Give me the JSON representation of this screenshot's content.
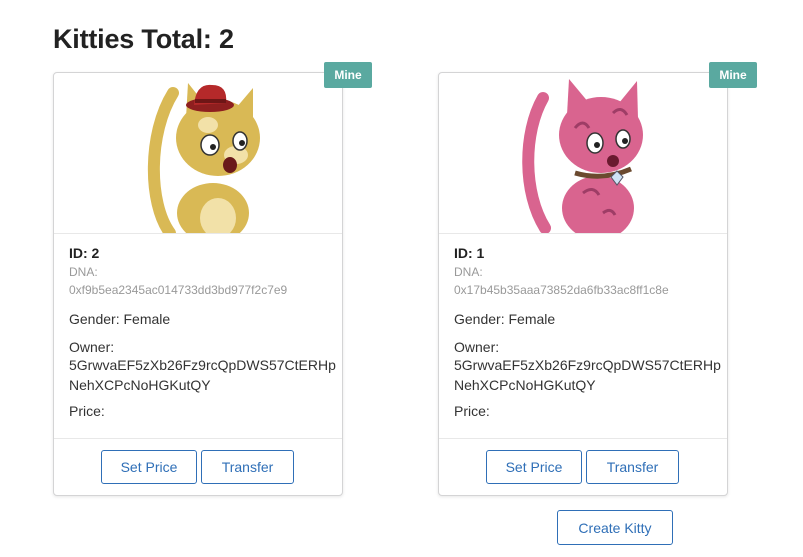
{
  "header": {
    "title": "Kitties Total: 2"
  },
  "kitties": [
    {
      "badge": "Mine",
      "id": "ID: 2",
      "dna_label": "DNA:",
      "dna": "0xf9b5ea2345ac014733dd3bd977f2c7e9",
      "gender": "Gender: Female",
      "owner_label": "Owner:",
      "owner": "5GrwvaEF5zXb26Fz9rcQpDWS57CtERHpNehXCPcNoHGKutQY",
      "price": "Price:",
      "set_price_label": "Set Price",
      "transfer_label": "Transfer",
      "image": "yellow-cat-with-red-hat",
      "body_color": "#d9b955",
      "accent_color": "#b5292a"
    },
    {
      "badge": "Mine",
      "id": "ID: 1",
      "dna_label": "DNA:",
      "dna": "0x17b45b35aaa73852da6fb33ac8ff1c8e",
      "gender": "Gender: Female",
      "owner_label": "Owner:",
      "owner": "5GrwvaEF5zXb26Fz9rcQpDWS57CtERHpNehXCPcNoHGKutQY",
      "price": "Price:",
      "set_price_label": "Set Price",
      "transfer_label": "Transfer",
      "image": "pink-cat-with-collar",
      "body_color": "#d9648f",
      "accent_color": "#9e3d66"
    }
  ],
  "actions": {
    "create_label": "Create Kitty"
  },
  "colors": {
    "badge": "#5aa9a0",
    "button": "#2f6fb7"
  }
}
